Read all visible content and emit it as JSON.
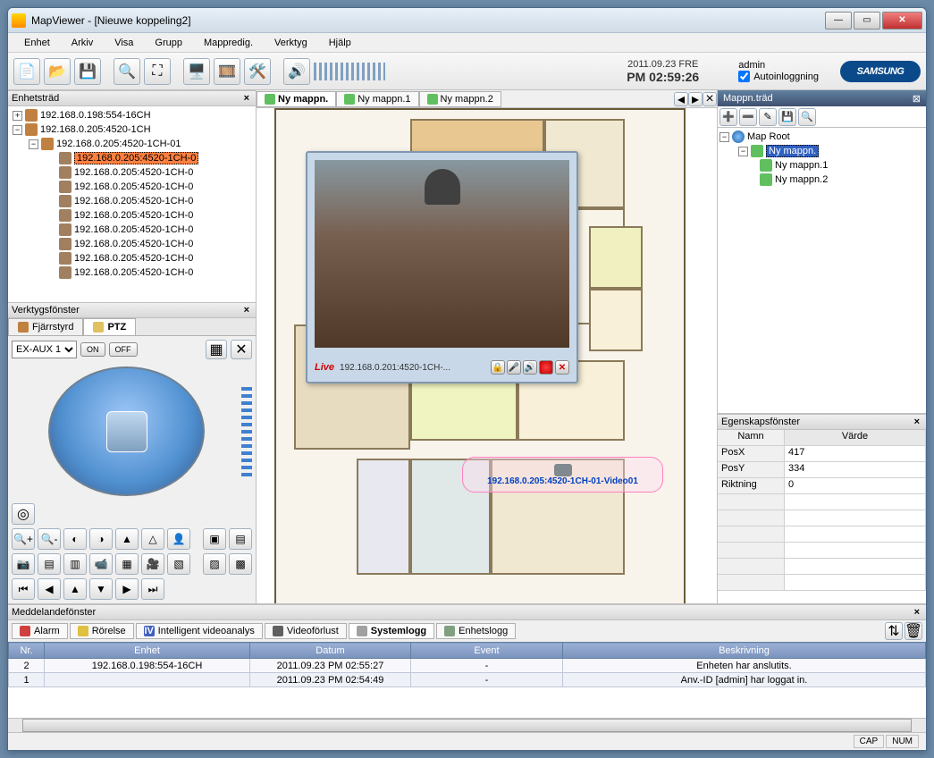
{
  "window": {
    "title": "MapViewer - [Nieuwe koppeling2]"
  },
  "menu": [
    "Enhet",
    "Arkiv",
    "Visa",
    "Grupp",
    "Mappredig.",
    "Verktyg",
    "Hjälp"
  ],
  "datetime": {
    "date": "2011.09.23  FRE",
    "time": "PM  02:59:26"
  },
  "user": {
    "name": "admin",
    "autologin_label": "Autoinloggning"
  },
  "brand": "SAMSUNG",
  "device_tree": {
    "title": "Enhetsträd",
    "nodes": [
      {
        "indent": 0,
        "box": "+",
        "label": "192.168.0.198:554-16CH"
      },
      {
        "indent": 0,
        "box": "−",
        "label": "192.168.0.205:4520-1CH"
      },
      {
        "indent": 1,
        "box": "−",
        "label": "192.168.0.205:4520-1CH-01"
      },
      {
        "indent": 2,
        "label": "192.168.0.205:4520-1CH-0",
        "selected": true
      },
      {
        "indent": 2,
        "label": "192.168.0.205:4520-1CH-0"
      },
      {
        "indent": 2,
        "label": "192.168.0.205:4520-1CH-0"
      },
      {
        "indent": 2,
        "label": "192.168.0.205:4520-1CH-0"
      },
      {
        "indent": 2,
        "label": "192.168.0.205:4520-1CH-0"
      },
      {
        "indent": 2,
        "label": "192.168.0.205:4520-1CH-0"
      },
      {
        "indent": 2,
        "label": "192.168.0.205:4520-1CH-0"
      },
      {
        "indent": 2,
        "label": "192.168.0.205:4520-1CH-0"
      },
      {
        "indent": 2,
        "label": "192.168.0.205:4520-1CH-0"
      }
    ]
  },
  "tools": {
    "title": "Verktygsfönster",
    "tabs": {
      "remote": "Fjärrstyrd",
      "ptz": "PTZ"
    },
    "aux": "EX-AUX 1",
    "on": "ON",
    "off": "OFF"
  },
  "map_tabs": [
    {
      "label": "Ny mappn.",
      "active": true
    },
    {
      "label": "Ny mappn.1"
    },
    {
      "label": "Ny mappn.2"
    }
  ],
  "live": {
    "tag": "Live",
    "ip": "192.168.0.201:4520-1CH-..."
  },
  "camera_marker": "192.168.0.205:4520-1CH-01-Video01",
  "map_tree": {
    "title": "Mappn.träd",
    "root": "Map Root",
    "children": [
      {
        "label": "Ny mappn.",
        "selected": true
      },
      {
        "label": "Ny mappn.1"
      },
      {
        "label": "Ny mappn.2"
      }
    ]
  },
  "props": {
    "title": "Egenskapsfönster",
    "headers": {
      "name": "Namn",
      "value": "Värde"
    },
    "rows": [
      {
        "name": "PosX",
        "value": "417"
      },
      {
        "name": "PosY",
        "value": "334"
      },
      {
        "name": "Riktning",
        "value": "0"
      }
    ]
  },
  "messages": {
    "title": "Meddelandefönster",
    "tabs": [
      "Alarm",
      "Rörelse",
      "Intelligent videoanalys",
      "Videoförlust",
      "Systemlogg",
      "Enhetslogg"
    ],
    "active_tab": 4,
    "headers": [
      "Nr.",
      "Enhet",
      "Datum",
      "Event",
      "Beskrivning"
    ],
    "rows": [
      {
        "nr": "2",
        "enhet": "192.168.0.198:554-16CH",
        "datum": "2011.09.23 PM 02:55:27",
        "event": "-",
        "beskr": "Enheten har anslutits."
      },
      {
        "nr": "1",
        "enhet": "",
        "datum": "2011.09.23 PM 02:54:49",
        "event": "-",
        "beskr": "Anv.-ID [admin] har loggat in."
      }
    ]
  },
  "status": [
    "CAP",
    "NUM"
  ]
}
